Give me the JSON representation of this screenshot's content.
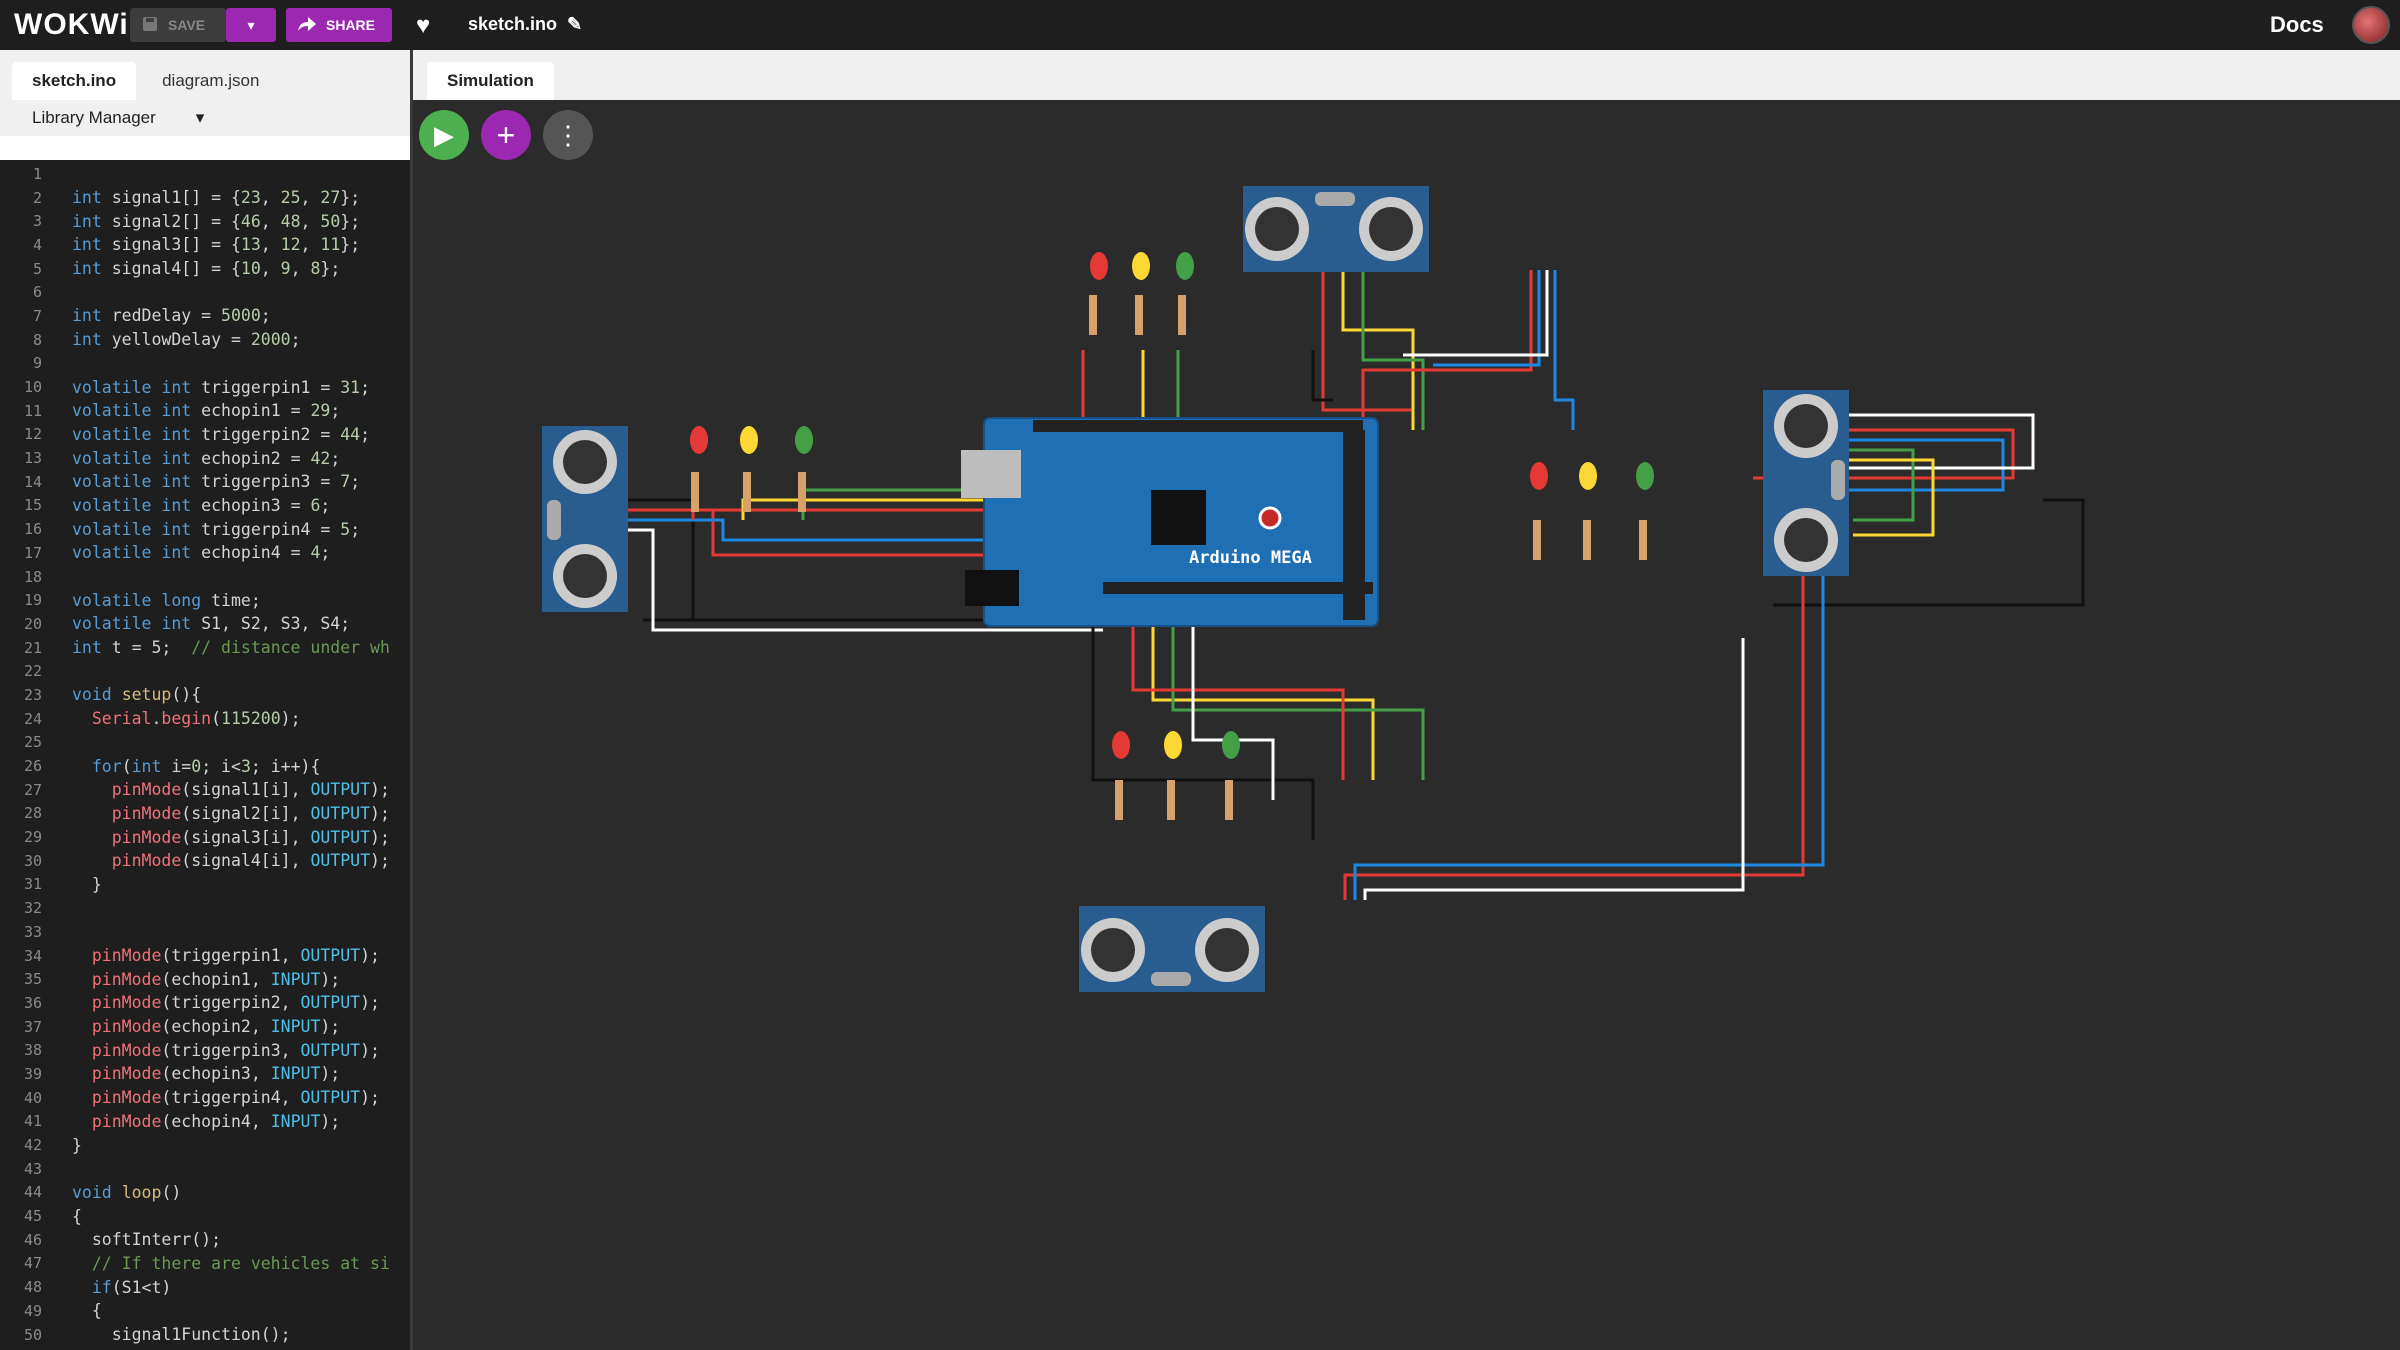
{
  "header": {
    "logo": "WOKWi",
    "save_label": "SAVE",
    "share_label": "SHARE",
    "project_title": "sketch.ino",
    "docs_label": "Docs"
  },
  "editor": {
    "tabs": [
      {
        "label": "sketch.ino",
        "active": true
      },
      {
        "label": "diagram.json",
        "active": false
      }
    ],
    "library_manager": "Library Manager",
    "lines": [
      "",
      "int signal1[] = {23, 25, 27};",
      "int signal2[] = {46, 48, 50};",
      "int signal3[] = {13, 12, 11};",
      "int signal4[] = {10, 9, 8};",
      "",
      "int redDelay = 5000;",
      "int yellowDelay = 2000;",
      "",
      "volatile int triggerpin1 = 31;",
      "volatile int echopin1 = 29;",
      "volatile int triggerpin2 = 44;",
      "volatile int echopin2 = 42;",
      "volatile int triggerpin3 = 7;",
      "volatile int echopin3 = 6;",
      "volatile int triggerpin4 = 5;",
      "volatile int echopin4 = 4;",
      "",
      "volatile long time;",
      "volatile int S1, S2, S3, S4;",
      "int t = 5;  // distance under wh",
      "",
      "void setup(){",
      "  Serial.begin(115200);",
      "",
      "  for(int i=0; i<3; i++){",
      "    pinMode(signal1[i], OUTPUT);",
      "    pinMode(signal2[i], OUTPUT);",
      "    pinMode(signal3[i], OUTPUT);",
      "    pinMode(signal4[i], OUTPUT);",
      "  }",
      "",
      "",
      "  pinMode(triggerpin1, OUTPUT);",
      "  pinMode(echopin1, INPUT);",
      "  pinMode(triggerpin2, OUTPUT);",
      "  pinMode(echopin2, INPUT);",
      "  pinMode(triggerpin3, OUTPUT);",
      "  pinMode(echopin3, INPUT);",
      "  pinMode(triggerpin4, OUTPUT);",
      "  pinMode(echopin4, INPUT);",
      "}",
      "",
      "void loop()",
      "{",
      "  softInterr();",
      "  // If there are vehicles at si",
      "  if(S1<t)",
      "  {",
      "    signal1Function();"
    ]
  },
  "simulation": {
    "tab_label": "Simulation",
    "board_label": "Arduino MEGA",
    "sensor_label": "HC-SR04",
    "colors": {
      "accent": "#9c27b0",
      "play": "#4caf50",
      "board": "#1f6fb5"
    }
  }
}
